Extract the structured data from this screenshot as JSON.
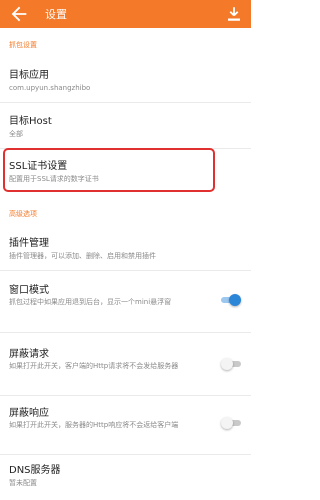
{
  "appbar": {
    "title": "设置",
    "bg": "#f47a29"
  },
  "sections": {
    "capture": "抓包设置",
    "advanced": "高级选项"
  },
  "items": {
    "target_app": {
      "title": "目标应用",
      "sub": "com.upyun.shangzhibo"
    },
    "target_host": {
      "title": "目标Host",
      "sub": "全部"
    },
    "ssl": {
      "title": "SSL证书设置",
      "sub": "配置用于SSL请求的数字证书"
    },
    "plugins": {
      "title": "插件管理",
      "sub": "插件管理器，可以添加、删除、启用和禁用插件"
    },
    "window_mode": {
      "title": "窗口模式",
      "sub": "抓包过程中如果应用退到后台，显示一个mini悬浮窗",
      "enabled": true
    },
    "block_request": {
      "title": "屏蔽请求",
      "sub": "如果打开此开关，客户端的Http请求将不会发给服务器",
      "enabled": false
    },
    "block_response": {
      "title": "屏蔽响应",
      "sub": "如果打开此开关，服务器的Http响应将不会返给客户端",
      "enabled": false
    },
    "dns": {
      "title": "DNS服务器",
      "sub": "暂未配置"
    }
  },
  "colors": {
    "accent": "#f47a29",
    "highlight": "#e03030",
    "switch_on": "#2b86d8"
  }
}
